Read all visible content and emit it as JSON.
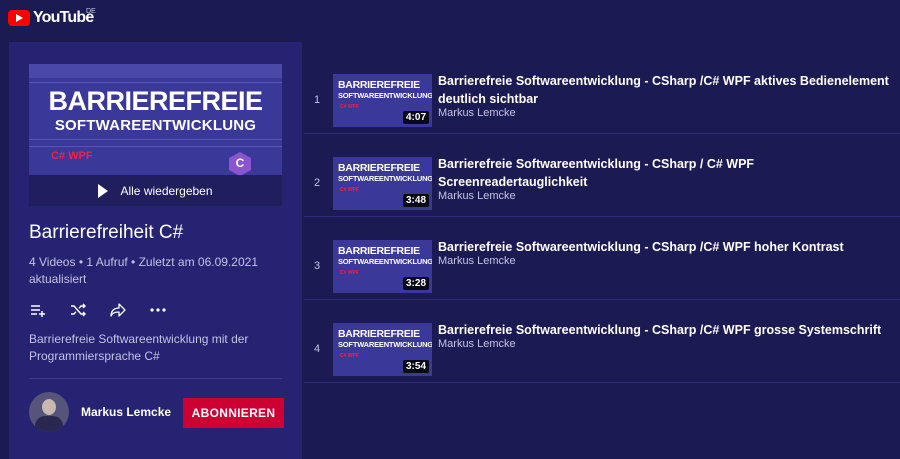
{
  "header": {
    "logo_text": "YouTube",
    "region": "DE"
  },
  "playlist": {
    "thumbnail": {
      "line1": "BARRIEREFREIE",
      "line2": "SOFTWAREENTWICKLUNG",
      "tag": "C# WPF",
      "badge_glyph": "C"
    },
    "play_all_label": "Alle wiedergeben",
    "title": "Barrierefreiheit C#",
    "stats": "4 Videos • 1 Aufruf • Zuletzt am 06.09.2021 aktualisiert",
    "actions": [
      "add-to-queue-icon",
      "shuffle-icon",
      "share-icon",
      "more-icon"
    ],
    "description": "Barrierefreie Softwareentwicklung mit der Programmiersprache C#",
    "channel": "Markus Lemcke",
    "subscribe_label": "ABONNIEREN"
  },
  "videos": [
    {
      "index": "1",
      "title": "Barrierefreie Softwareentwicklung - CSharp /C# WPF aktives Bedienelement deutlich sichtbar",
      "channel": "Markus Lemcke",
      "duration": "4:07",
      "thumb_line1": "BARRIEREFREIE",
      "thumb_line2": "SOFTWAREENTWICKLUNG"
    },
    {
      "index": "2",
      "title": "Barrierefreie Softwareentwicklung - CSharp / C# WPF Screenreadertauglichkeit",
      "channel": "Markus Lemcke",
      "duration": "3:48",
      "thumb_line1": "BARRIEREFREIE",
      "thumb_line2": "SOFTWAREENTWICKLUNG"
    },
    {
      "index": "3",
      "title": "Barrierefreie Softwareentwicklung - CSharp /C# WPF hoher Kontrast",
      "channel": "Markus Lemcke",
      "duration": "3:28",
      "thumb_line1": "BARRIEREFREIE",
      "thumb_line2": "SOFTWAREENTWICKLUNG"
    },
    {
      "index": "4",
      "title": "Barrierefreie Softwareentwicklung - CSharp /C# WPF grosse Systemschrift",
      "channel": "Markus Lemcke",
      "duration": "3:54",
      "thumb_line1": "BARRIEREFREIE",
      "thumb_line2": "SOFTWAREENTWICKLUNG"
    }
  ],
  "colors": {
    "background": "#1c1a52",
    "sidebar": "#252372",
    "subscribe": "#cc0033",
    "logo_red": "#ff0000",
    "secondary_text": "#c4c3e6"
  }
}
